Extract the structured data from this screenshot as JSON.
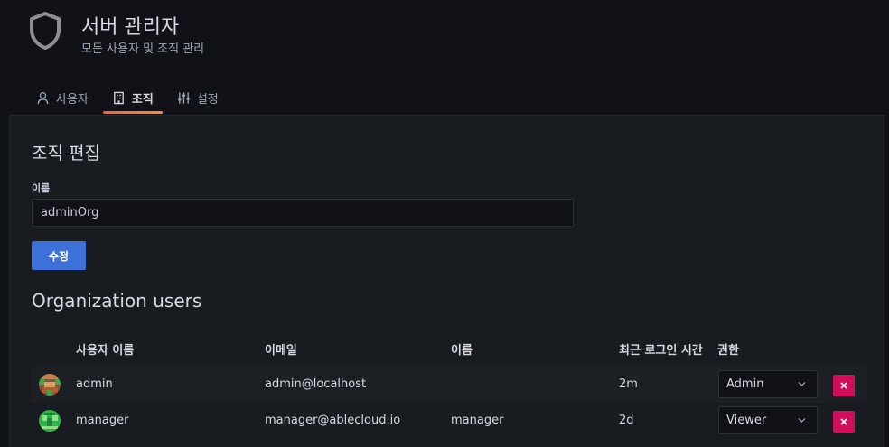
{
  "header": {
    "title": "서버 관리자",
    "subtitle": "모든 사용자 및 조직 관리",
    "icon": "shield-icon"
  },
  "tabs": [
    {
      "label": "사용자",
      "icon": "user-icon",
      "active": false
    },
    {
      "label": "조직",
      "icon": "building-icon",
      "active": true
    },
    {
      "label": "설정",
      "icon": "sliders-icon",
      "active": false
    }
  ],
  "edit_form": {
    "heading": "조직 편집",
    "name_label": "이름",
    "name_value": "adminOrg",
    "save_label": "수정"
  },
  "users": {
    "heading": "Organization users",
    "columns": [
      "사용자 이름",
      "이메일",
      "이름",
      "최근 로그인 시간",
      "권한"
    ],
    "rows": [
      {
        "login": "admin",
        "email": "admin@localhost",
        "name": "",
        "last_seen": "2m",
        "role": "Admin"
      },
      {
        "login": "manager",
        "email": "manager@ablecloud.io",
        "name": "manager",
        "last_seen": "2d",
        "role": "Viewer"
      }
    ]
  },
  "colors": {
    "background": "#111217",
    "panel": "#181b1f",
    "primary_button": "#3d71d9",
    "danger_button": "#d10e5c",
    "active_tab_gradient": [
      "#f55f3e",
      "#ff8833"
    ]
  }
}
